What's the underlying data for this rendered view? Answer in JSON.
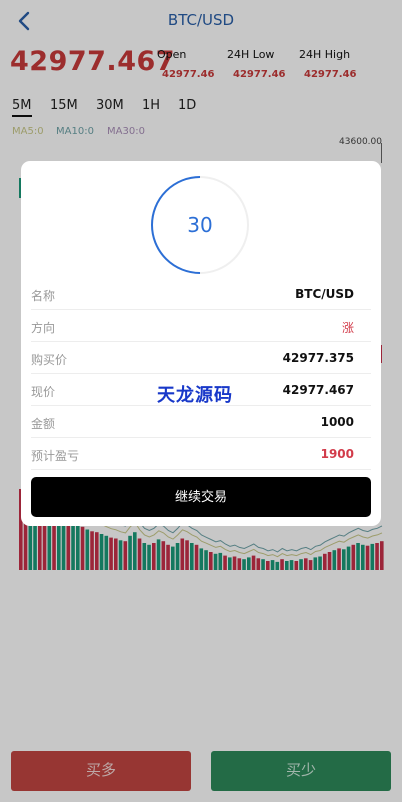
{
  "header": {
    "title": "BTC/USD",
    "back_icon": "chevron-left-icon"
  },
  "ticker": {
    "price": "42977.467",
    "stats": [
      {
        "label": "Open",
        "value": "42977.46"
      },
      {
        "label": "24H Low",
        "value": "42977.46"
      },
      {
        "label": "24H High",
        "value": "42977.46"
      }
    ]
  },
  "periods": [
    "5M",
    "15M",
    "30M",
    "1H",
    "1D"
  ],
  "active_period": "5M",
  "ma": [
    {
      "label": "MA5:0",
      "color": "#c9c98a"
    },
    {
      "label": "MA10:0",
      "color": "#6fa3a8"
    },
    {
      "label": "MA30:0",
      "color": "#a98fb8"
    }
  ],
  "axis": {
    "top_label": "43600.00"
  },
  "volume": {
    "values": [
      0.9,
      0.82,
      0.75,
      0.72,
      0.7,
      0.68,
      0.67,
      0.65,
      0.63,
      0.6,
      0.55,
      0.52,
      0.5,
      0.48,
      0.45,
      0.43,
      0.42,
      0.4,
      0.38,
      0.36,
      0.35,
      0.33,
      0.32,
      0.38,
      0.42,
      0.35,
      0.3,
      0.28,
      0.3,
      0.34,
      0.32,
      0.28,
      0.26,
      0.3,
      0.35,
      0.33,
      0.3,
      0.28,
      0.24,
      0.22,
      0.2,
      0.18,
      0.19,
      0.16,
      0.14,
      0.15,
      0.13,
      0.12,
      0.14,
      0.16,
      0.13,
      0.12,
      0.1,
      0.11,
      0.09,
      0.12,
      0.1,
      0.11,
      0.1,
      0.12,
      0.13,
      0.11,
      0.14,
      0.15,
      0.18,
      0.2,
      0.22,
      0.24,
      0.23,
      0.26,
      0.28,
      0.3,
      0.28,
      0.27,
      0.29,
      0.3,
      0.32
    ],
    "colors_up": "#1a9a7a",
    "colors_down": "#c8304a"
  },
  "dialog": {
    "countdown": "30",
    "rows": [
      {
        "key": "名称",
        "value": "BTC/USD",
        "red": false
      },
      {
        "key": "方向",
        "value": "涨",
        "red": true
      },
      {
        "key": "购买价",
        "value": "42977.375",
        "red": false
      },
      {
        "key": "现价",
        "value": "42977.467",
        "red": false
      },
      {
        "key": "金额",
        "value": "1000",
        "red": false
      },
      {
        "key": "预计盈亏",
        "value": "1900",
        "red": true
      }
    ],
    "watermark": "天龙源码",
    "continue_label": "继续交易"
  },
  "buttons": {
    "buy_label": "买多",
    "sell_label": "买少"
  }
}
